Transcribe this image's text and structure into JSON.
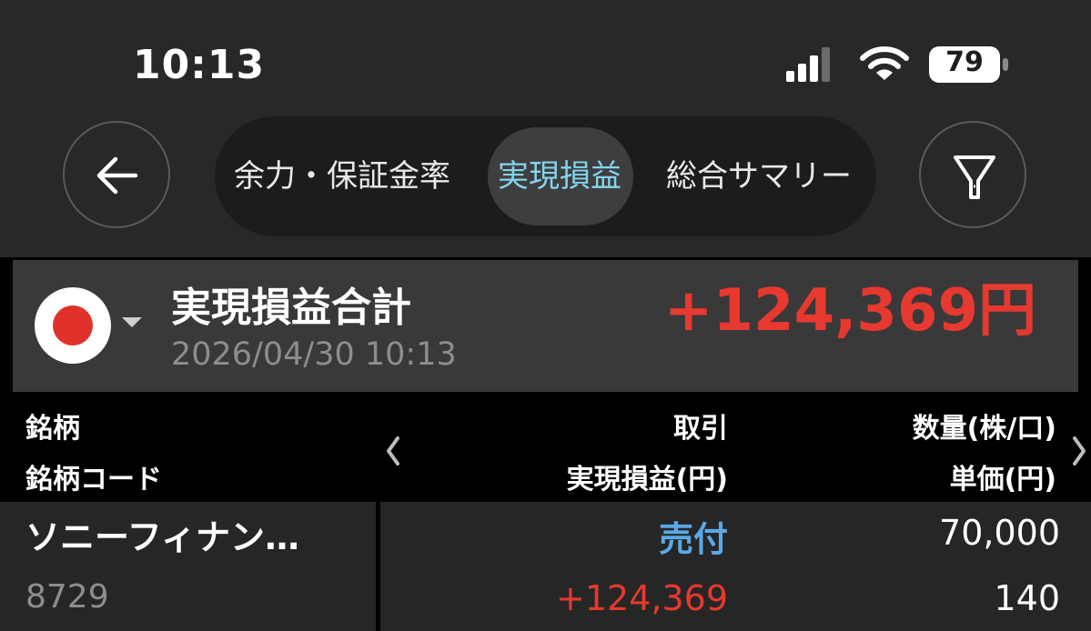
{
  "status_bar": {
    "time": "10:13",
    "battery": "79"
  },
  "nav": {
    "tabs": [
      {
        "label": "余力・保証金率",
        "active": false
      },
      {
        "label": "実現損益",
        "active": true
      },
      {
        "label": "総合サマリー",
        "active": false
      }
    ]
  },
  "summary": {
    "title": "実現損益合計",
    "date": "2026/04/30 10:13",
    "value": "+124,369円"
  },
  "table": {
    "headers": {
      "col1_line1": "銘柄",
      "col1_line2": "銘柄コード",
      "col2_line1": "取引",
      "col2_line2": "実現損益(円)",
      "col3_line1": "数量(株/口)",
      "col3_line2": "単価(円)"
    },
    "rows": [
      {
        "name": "ソニーフィナン…",
        "code": "8729",
        "trade": "売付",
        "pnl": "+124,369",
        "quantity": "70,000",
        "price": "140"
      }
    ]
  },
  "colors": {
    "accent_tab": "#83d4ed",
    "profit": "#e6392f",
    "sell": "#5aa9e6",
    "flag_red": "#e0322a"
  }
}
